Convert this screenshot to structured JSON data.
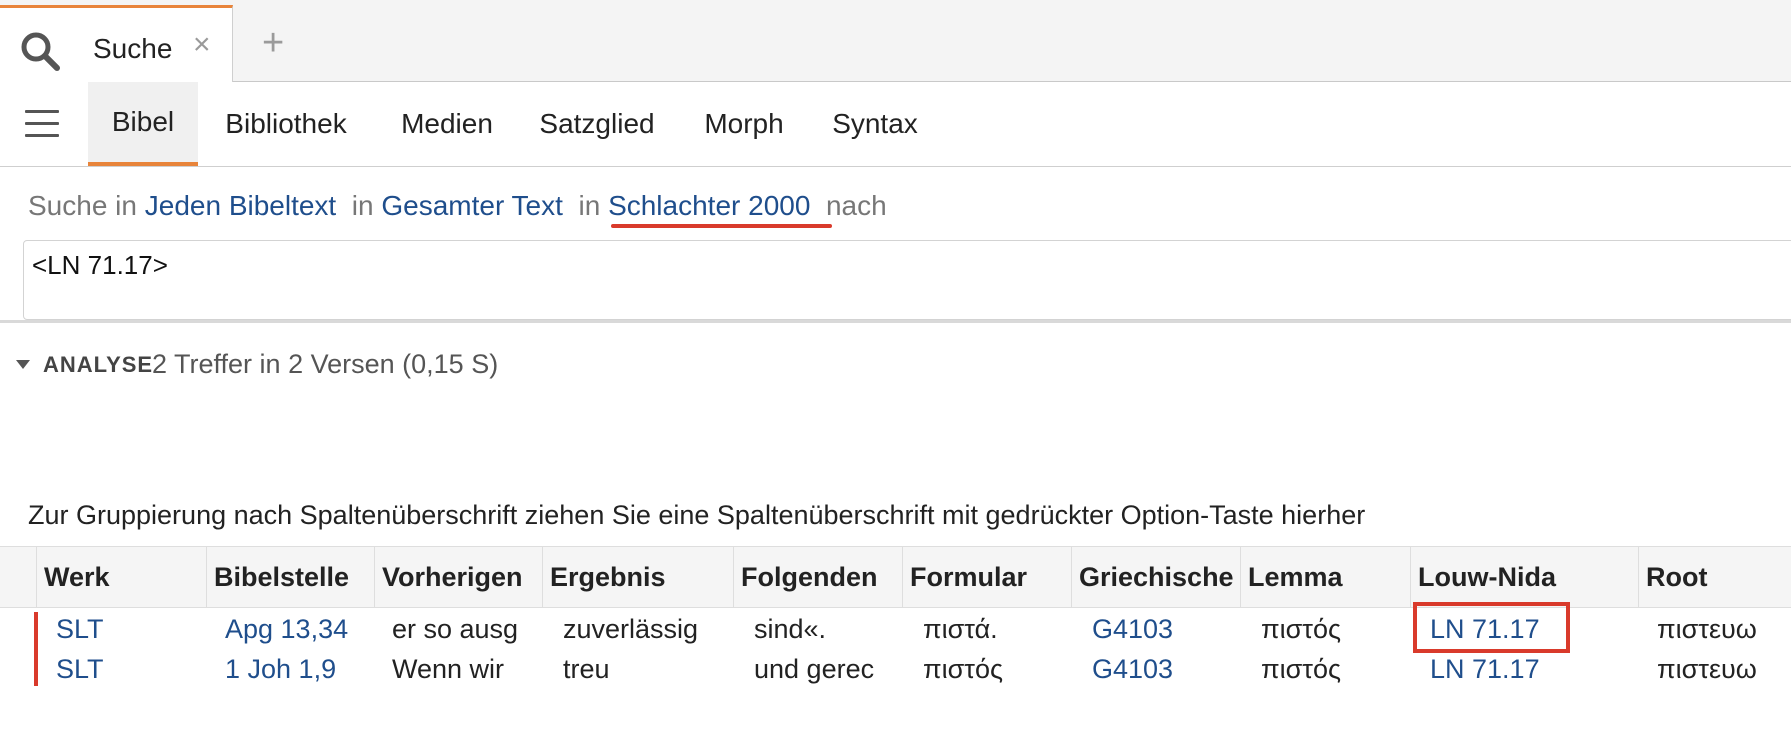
{
  "tab": {
    "label": "Suche",
    "close_glyph": "×",
    "add_glyph": "+",
    "icon": "search-icon"
  },
  "nav": {
    "menu_icon": "hamburger-menu-icon",
    "tabs": [
      "Bibel",
      "Bibliothek",
      "Medien",
      "Satzglied",
      "Morph",
      "Syntax"
    ],
    "active": "Bibel"
  },
  "search": {
    "prefix": "Suche in",
    "scope": "Jeden Bibeltext",
    "in1": "in",
    "range": "Gesamter Text",
    "in2": "in",
    "version": "Schlachter 2000",
    "suffix": "nach",
    "query": "<LN 71.17>"
  },
  "analysis": {
    "title": "ANALYSE",
    "summary": "2 Treffer in 2 Versen (0,15 S)"
  },
  "grid": {
    "group_hint": "Zur Gruppierung nach Spaltenüberschrift ziehen Sie eine Spaltenüberschrift mit gedrückter Option-Taste hierher",
    "columns": [
      "Werk",
      "Bibelstelle",
      "Vorherigen",
      "Ergebnis",
      "Folgenden",
      "Formular",
      "Griechische",
      "Lemma",
      "Louw-Nida",
      "Root"
    ],
    "rows": [
      {
        "werk": "SLT",
        "bibelstelle": "Apg 13,34",
        "vorherigen": "er so ausg",
        "ergebnis": "zuverlässig",
        "folgenden": "sind«.",
        "formular": "πιστά.",
        "griechische": "G4103",
        "lemma": "πιστός",
        "louw_nida": "LN 71.17",
        "root": "πιστευω"
      },
      {
        "werk": "SLT",
        "bibelstelle": "1 Joh 1,9",
        "vorherigen": "Wenn wir",
        "ergebnis": "treu",
        "folgenden": "und gerec",
        "formular": "πιστός",
        "griechische": "G4103",
        "lemma": "πιστός",
        "louw_nida": "LN 71.17",
        "root": "πιστευω"
      }
    ]
  },
  "colors": {
    "accent": "#e8843a",
    "link": "#1f4e8c",
    "annotation": "#d93a2b"
  }
}
